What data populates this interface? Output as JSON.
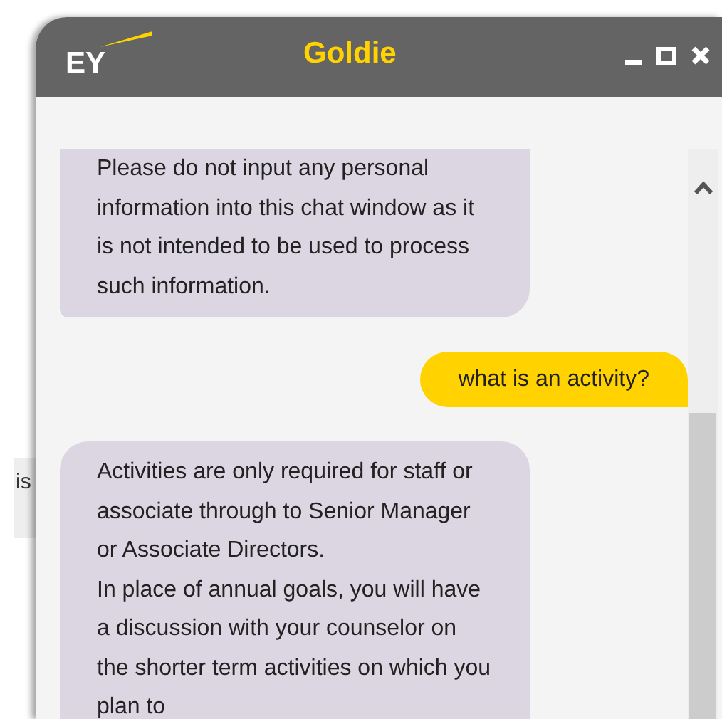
{
  "background": {
    "text": "is"
  },
  "window": {
    "title": "Goldie",
    "logo": "EY"
  },
  "messages": [
    {
      "kind": "bot",
      "text": "Please do not input any personal information into this chat window as it is not intended to be used to process such information."
    },
    {
      "kind": "user",
      "text": "what is an activity?"
    },
    {
      "kind": "bot",
      "text": "Activities are only required for staff or associate through to Senior Manager or Associate Directors.\nIn place of annual goals, you will have a discussion with your counselor on the shorter term activities on which you plan to"
    }
  ]
}
